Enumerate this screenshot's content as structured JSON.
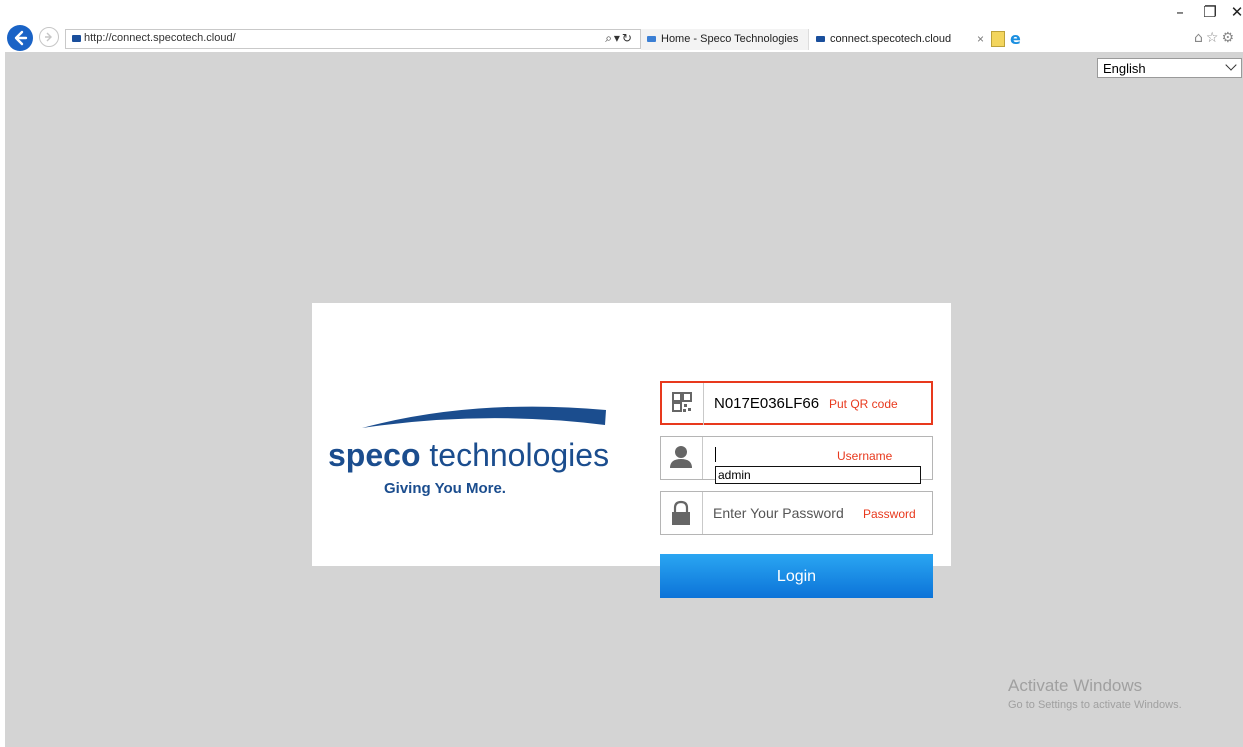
{
  "window": {
    "minimize_icon": "minimize-icon",
    "restore_icon": "restore-icon",
    "close_icon": "close-icon"
  },
  "browser": {
    "address_url": "http://connect.specotech.cloud/",
    "tabs": [
      {
        "label": "Home - Speco Technologies"
      },
      {
        "label": "connect.specotech.cloud"
      }
    ]
  },
  "language": {
    "selected": "English"
  },
  "logo": {
    "brand_bold": "speco",
    "brand_rest": " technologies",
    "tagline": "Giving You More."
  },
  "login": {
    "qr_value": "N017E036LF66",
    "qr_note": "Put QR code",
    "username_note": "Username",
    "username_value": "admin",
    "password_placeholder": "Enter Your Password",
    "password_note": "Password",
    "button_label": "Login"
  },
  "watermark": {
    "title": "Activate Windows",
    "subtitle": "Go to Settings to activate Windows."
  },
  "colors": {
    "page_bg": "#d4d4d4",
    "accent": "#e8391d",
    "button": "#1a8de6",
    "brand_blue": "#1b4d8e"
  }
}
